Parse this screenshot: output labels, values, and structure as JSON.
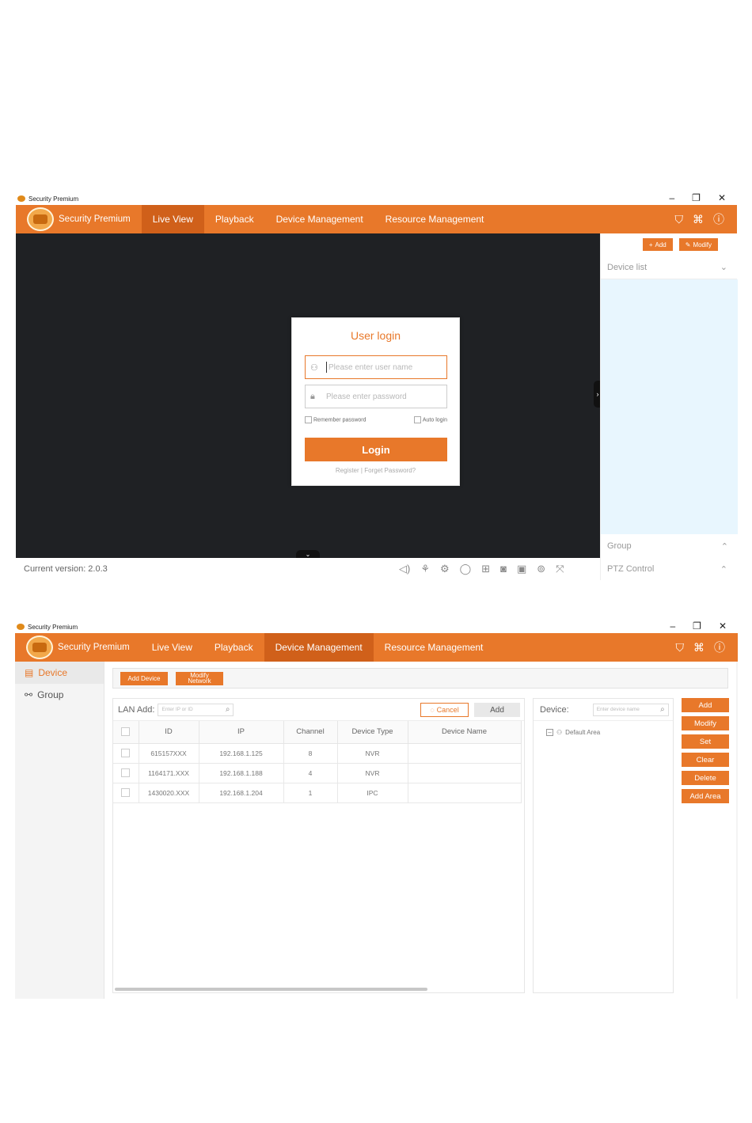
{
  "app_name": "Security Premium",
  "window_controls": [
    "–",
    "❐",
    "✕"
  ],
  "nav": {
    "brand": "Security Premium",
    "items": [
      "Live View",
      "Playback",
      "Device Management",
      "Resource Management"
    ],
    "right_icons": [
      "skin-icon",
      "command-icon",
      "help-icon"
    ]
  },
  "live_view": {
    "active_tab": "Live View",
    "login": {
      "title": "User login",
      "username_placeholder": "Please enter user name",
      "password_placeholder": "Please enter password",
      "remember": "Remember password",
      "auto_login": "Auto login",
      "button": "Login",
      "register": "Register",
      "separator": "|",
      "forget": "Forget Password?"
    },
    "right_panel": {
      "add": "Add",
      "modify": "Modify",
      "device_list": "Device list",
      "group": "Group",
      "ptz": "PTZ Control"
    },
    "version": "Current version: 2.0.3",
    "toolbar_icons": [
      "volume-icon",
      "talk-icon",
      "settings-icon",
      "record-icon",
      "split-screen-icon",
      "snapshot-icon",
      "video-record-icon",
      "fisheye-360-icon",
      "fullscreen-icon"
    ]
  },
  "device_management": {
    "active_tab": "Device Management",
    "sidebar": [
      {
        "label": "Device",
        "active": true
      },
      {
        "label": "Group",
        "active": false
      }
    ],
    "toolbar": {
      "add_device": "Add Device",
      "modify_network_1": "Modify",
      "modify_network_2": "Network"
    },
    "lan": {
      "label": "LAN Add:",
      "search_placeholder": "Enter IP or ID",
      "cancel": "Cancel",
      "add": "Add",
      "columns": [
        "ID",
        "IP",
        "Channel",
        "Device Type",
        "Device Name"
      ],
      "rows": [
        [
          "615157XXX",
          "192.168.1.125",
          "8",
          "NVR",
          ""
        ],
        [
          "1164171.XXX",
          "192.168.1.188",
          "4",
          "NVR",
          ""
        ],
        [
          "1430020.XXX",
          "192.168.1.204",
          "1",
          "IPC",
          ""
        ]
      ]
    },
    "device_tree": {
      "label": "Device:",
      "search_placeholder": "Enter device name",
      "root": "Default Area"
    },
    "actions": [
      "Add",
      "Modify",
      "Set",
      "Clear",
      "Delete",
      "Add Area"
    ]
  },
  "colors": {
    "accent": "#e8782a",
    "active_tab": "#d0601a",
    "video_bg": "#1f2124",
    "device_list_bg": "#e8f6fe"
  }
}
